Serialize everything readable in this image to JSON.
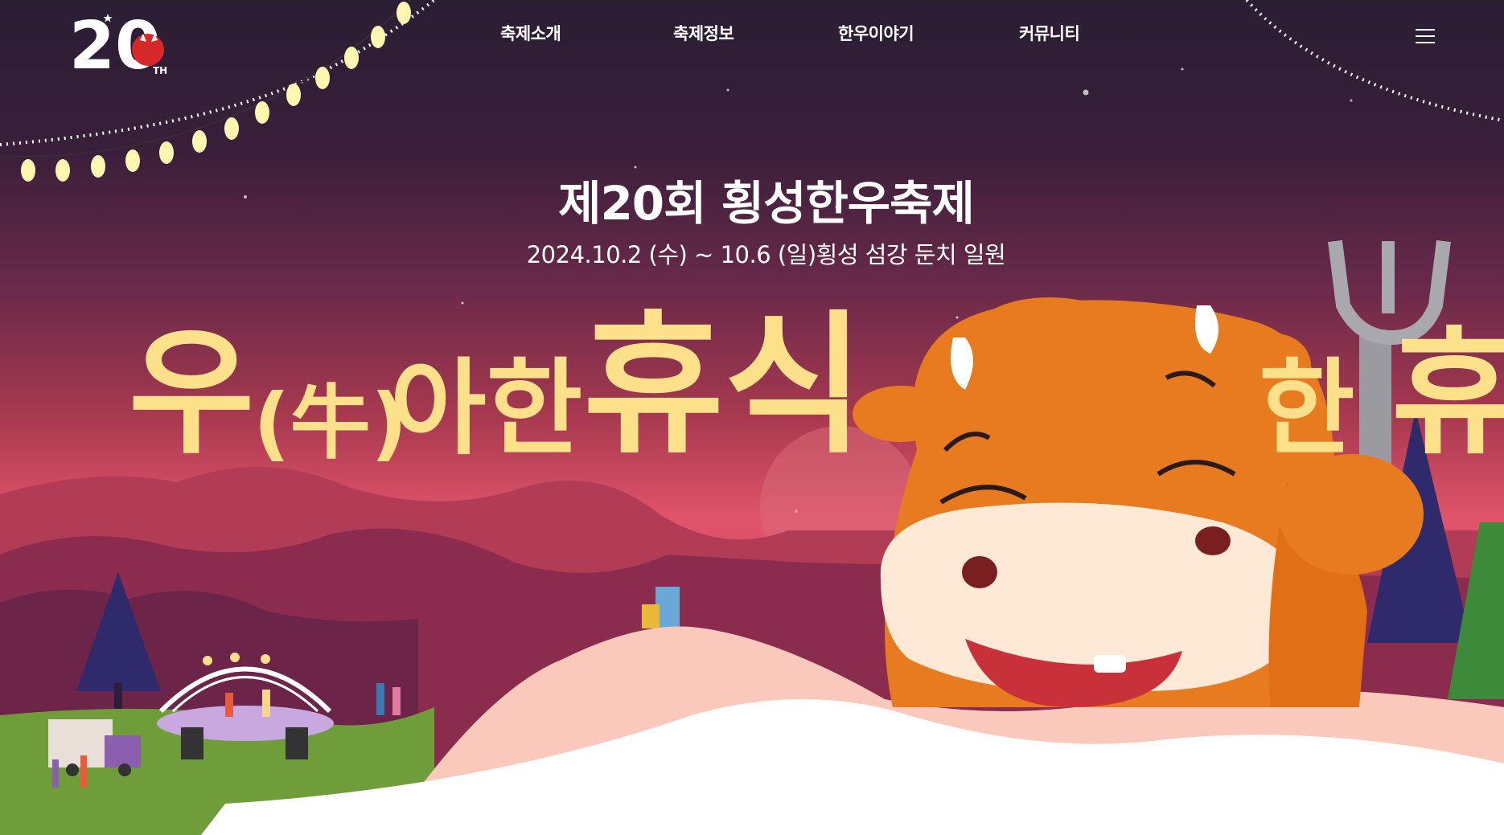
{
  "header": {
    "logo_text": "20",
    "logo_suffix": "TH",
    "nav": [
      {
        "label": "축제소개"
      },
      {
        "label": "축제정보"
      },
      {
        "label": "한우이야기"
      },
      {
        "label": "커뮤니티"
      }
    ],
    "menu_icon": "hamburger-icon"
  },
  "hero": {
    "title": "제20회 횡성한우축제",
    "date": "2024.10.2 (수) ~ 10.6 (일)횡성 섬강 둔치 일원",
    "slogan_1": "우",
    "slogan_2": "(牛)",
    "slogan_3": "아한",
    "slogan_4": "휴식",
    "slogan_5": "한",
    "slogan_6": "휴"
  },
  "colors": {
    "sky_top": "#2a1e33",
    "sky_mid": "#7e2d4e",
    "sky_low": "#e0546a",
    "slogan": "#fde08a",
    "cow_orange": "#e87a1f",
    "ground_pink": "#fbc8bc",
    "grass": "#6f9d3a"
  }
}
